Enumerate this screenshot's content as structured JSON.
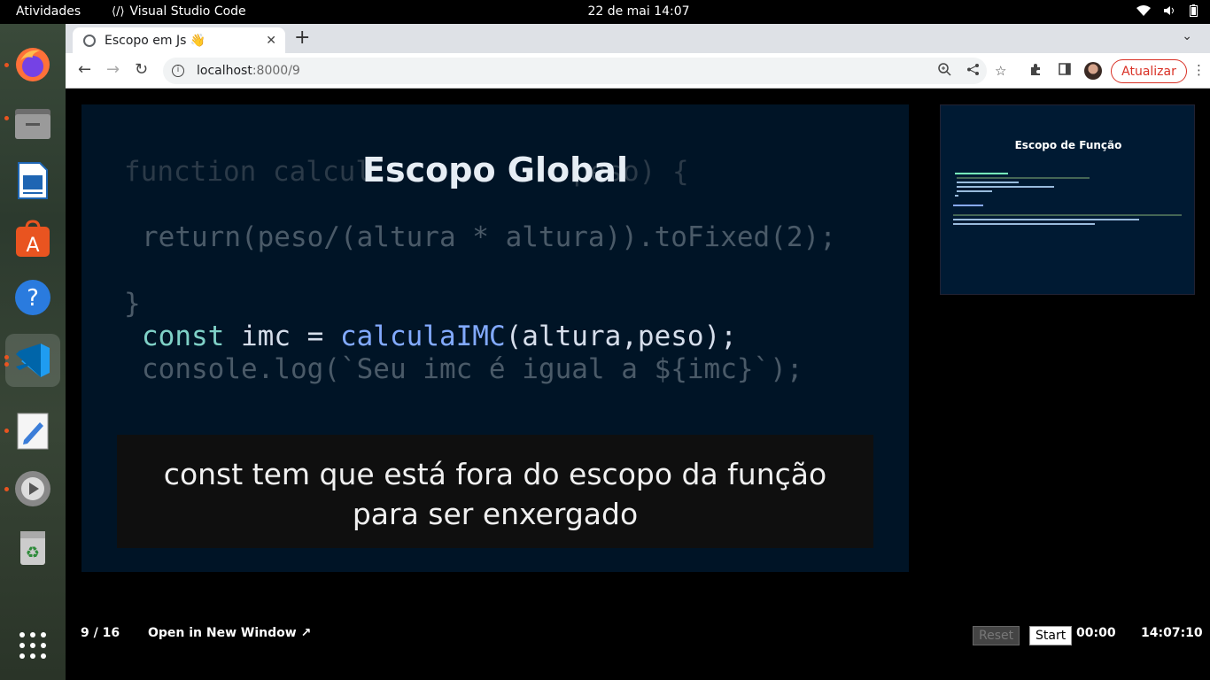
{
  "topbar": {
    "activities": "Atividades",
    "app_name": "Visual Studio Code",
    "clock": "22 de mai  14:07"
  },
  "browser": {
    "tab_title": "Escopo em Js 👋",
    "url_host": "localhost",
    "url_path": ":8000/9",
    "update_label": "Atualizar"
  },
  "slide": {
    "title": "Escopo Global",
    "code_lines": {
      "fn_line": "function calcul",
      "fn_line_end": "peso) {",
      "return_line": "return(peso/(altura * altura)).toFixed(2);",
      "close_brace": "}",
      "const_kw": "const",
      "const_rest": " imc = ",
      "call_name": "calculaIMC",
      "call_args": "(altura,peso);",
      "console_line": "console.log(`Seu imc é igual a ${imc}`);"
    },
    "caption_line1": "const tem que está fora do escopo da função",
    "caption_line2": "para ser enxergado"
  },
  "preview": {
    "title": "Escopo de Função"
  },
  "footer": {
    "page_counter": "9 / 16",
    "open_new_window": "Open in New Window ↗",
    "reset_label": "Reset",
    "start_label": "Start",
    "timer": "00:00",
    "time": "14:07:10"
  }
}
